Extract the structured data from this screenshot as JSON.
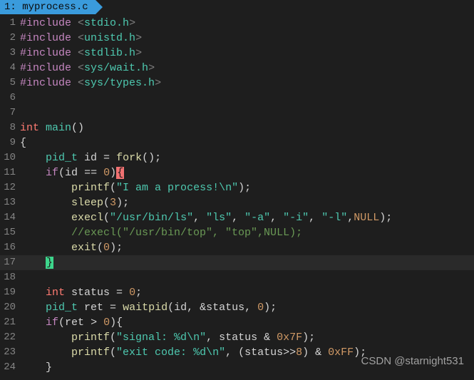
{
  "tab": {
    "index": "1:",
    "filename": "myprocess.c"
  },
  "lines": {
    "l1": {
      "n": "1",
      "pp": "#include",
      "lb": "<",
      "path": "stdio.h",
      "rb": ">"
    },
    "l2": {
      "n": "2",
      "pp": "#include",
      "lb": "<",
      "path": "unistd.h",
      "rb": ">"
    },
    "l3": {
      "n": "3",
      "pp": "#include",
      "lb": "<",
      "path": "stdlib.h",
      "rb": ">"
    },
    "l4": {
      "n": "4",
      "pp": "#include",
      "lb": "<",
      "path": "sys/wait.h",
      "rb": ">"
    },
    "l5": {
      "n": "5",
      "pp": "#include",
      "lb": "<",
      "path": "sys/types.h",
      "rb": ">"
    },
    "l6": {
      "n": "6"
    },
    "l7": {
      "n": "7"
    },
    "l8": {
      "n": "8",
      "type": "int",
      "fn": "main",
      "paren": "()"
    },
    "l9": {
      "n": "9",
      "brace": "{"
    },
    "l10": {
      "n": "10",
      "indent": "    ",
      "type": "pid_t",
      "var": " id ",
      "eq": "=",
      "sp": " ",
      "fn": "fork",
      "paren": "();"
    },
    "l11": {
      "n": "11",
      "indent": "    ",
      "kw": "if",
      "open": "(",
      "var": "id ",
      "op": "==",
      "sp": " ",
      "num": "0",
      "close": ")",
      "brace": "{"
    },
    "l12": {
      "n": "12",
      "indent": "        ",
      "fn": "printf",
      "open": "(",
      "str": "\"I am a process!\\n\"",
      "close": ");"
    },
    "l13": {
      "n": "13",
      "indent": "        ",
      "fn": "sleep",
      "open": "(",
      "num": "3",
      "close": ");"
    },
    "l14": {
      "n": "14",
      "indent": "        ",
      "fn": "execl",
      "open": "(",
      "s1": "\"/usr/bin/ls\"",
      "c1": ", ",
      "s2": "\"ls\"",
      "c2": ", ",
      "s3": "\"-a\"",
      "c3": ", ",
      "s4": "\"-i\"",
      "c4": ", ",
      "s5": "\"-l\"",
      "c5": ",",
      "null": "NULL",
      "close": ");"
    },
    "l15": {
      "n": "15",
      "indent": "        ",
      "comment": "//execl(\"/usr/bin/top\", \"top\",NULL);"
    },
    "l16": {
      "n": "16",
      "indent": "        ",
      "fn": "exit",
      "open": "(",
      "num": "0",
      "close": ");"
    },
    "l17": {
      "n": "17",
      "indent": "    ",
      "brace": "}"
    },
    "l18": {
      "n": "18"
    },
    "l19": {
      "n": "19",
      "indent": "    ",
      "type": "int",
      "var": " status ",
      "eq": "=",
      "sp": " ",
      "num": "0",
      "semi": ";"
    },
    "l20": {
      "n": "20",
      "indent": "    ",
      "type": "pid_t",
      "var": " ret ",
      "eq": "=",
      "sp": " ",
      "fn": "waitpid",
      "open": "(",
      "args": "id, &status, ",
      "num": "0",
      "close": ");"
    },
    "l21": {
      "n": "21",
      "indent": "    ",
      "kw": "if",
      "open": "(",
      "var": "ret ",
      "op": ">",
      "sp": " ",
      "num": "0",
      "close": "){"
    },
    "l22": {
      "n": "22",
      "indent": "        ",
      "fn": "printf",
      "open": "(",
      "str": "\"signal: %d\\n\"",
      "c1": ", status & ",
      "hex": "0x7F",
      "close": ");"
    },
    "l23": {
      "n": "23",
      "indent": "        ",
      "fn": "printf",
      "open": "(",
      "str": "\"exit code: %d\\n\"",
      "c1": ", (status>>",
      "n1": "8",
      "c2": ") & ",
      "hex": "0xFF",
      "close": ");"
    },
    "l24": {
      "n": "24",
      "indent": "    ",
      "brace": "}"
    }
  },
  "watermark": "CSDN @starnight531"
}
